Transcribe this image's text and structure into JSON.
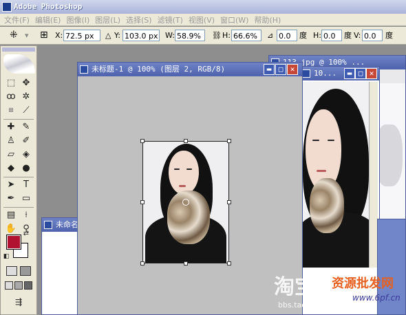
{
  "app": {
    "title": "Adobe Photoshop"
  },
  "menu": [
    "文件(F)",
    "编辑(E)",
    "图像(I)",
    "图层(L)",
    "选择(S)",
    "滤镜(T)",
    "视图(V)",
    "窗口(W)",
    "帮助(H)"
  ],
  "options": {
    "x_label": "X:",
    "x_value": "72.5 px",
    "y_label": "Y:",
    "y_value": "103.0 px",
    "w_label": "W:",
    "w_value": "58.9%",
    "h_label": "H:",
    "h_value": "66.6%",
    "angle_value": "0.0",
    "angle_unit": "度",
    "hskew_label": "H:",
    "hskew_value": "0.0",
    "hskew_unit": "度",
    "vskew_label": "V:",
    "vskew_value": "0.0"
  },
  "documents": {
    "main": {
      "title": "未标题-1 @ 100% (图层 2, RGB/8)"
    },
    "back_right": {
      "title": "113.jpg @ 100% ..."
    },
    "middle": {
      "title": "10..."
    },
    "bottom_left": {
      "title": "未命名"
    }
  },
  "colors": {
    "foreground": "#b01230",
    "background": "#ffffff",
    "title_bar": "#5066b2",
    "canvas_gray": "#c0c0c0",
    "workspace": "#8e8e8e"
  },
  "watermark": {
    "logo_text": "淘宝",
    "site": "bbs.taobao.com",
    "brand": "资源批发网",
    "brand_url": "www.6pf.cn"
  }
}
